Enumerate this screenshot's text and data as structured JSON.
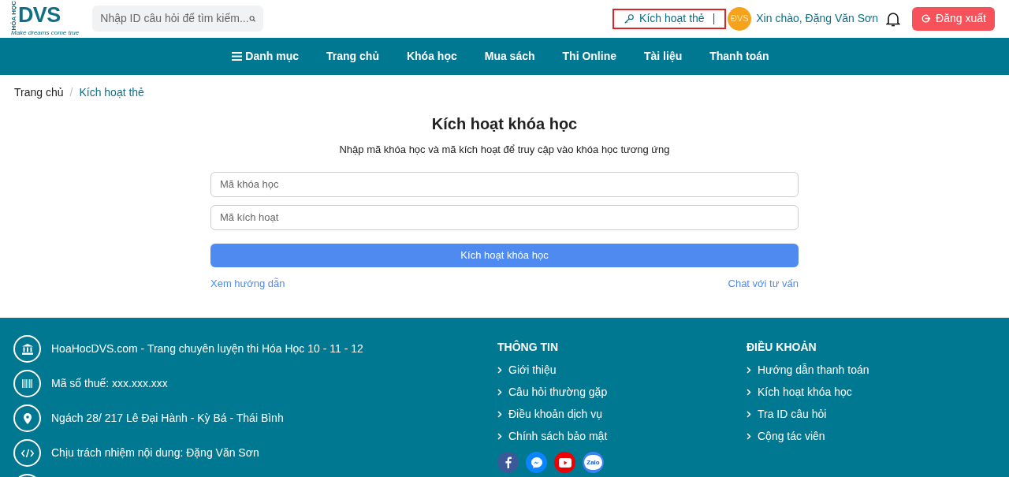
{
  "header": {
    "logo": {
      "vertical": "HÓA HỌC",
      "main": "DVS",
      "tagline": "Make dreams come true"
    },
    "search": {
      "placeholder": "Nhập ID câu hỏi để tìm kiếm..."
    },
    "activate_link": {
      "label": "Kích hoạt thẻ",
      "separator": "|",
      "highlighted": true
    },
    "avatar": "ĐVS",
    "greeting": "Xin chào, Đặng Văn Sơn",
    "logout": "Đăng xuất"
  },
  "nav": [
    {
      "label": "Danh mục",
      "kind": "menu"
    },
    {
      "label": "Trang chủ",
      "kind": "link"
    },
    {
      "label": "Khóa học",
      "kind": "link"
    },
    {
      "label": "Mua sách",
      "kind": "link"
    },
    {
      "label": "Thi Online",
      "kind": "link"
    },
    {
      "label": "Tài liệu",
      "kind": "link"
    },
    {
      "label": "Thanh toán",
      "kind": "link"
    }
  ],
  "breadcrumb_separator": "/",
  "breadcrumb": [
    {
      "label": "Trang chủ",
      "selected": false
    },
    {
      "label": "Kích hoạt thẻ",
      "selected": true
    }
  ],
  "form": {
    "title": "Kích hoạt khóa học",
    "subtitle": "Nhập mã khóa học và mã kích hoạt để truy cập vào khóa học tương ứng",
    "fields": [
      {
        "placeholder": "Mã khóa học"
      },
      {
        "placeholder": "Mã kích hoạt"
      }
    ],
    "submit": "Kích hoạt khóa học",
    "help_link": "Xem hướng dẫn",
    "chat_link": "Chat với tư vấn"
  },
  "footer": {
    "info": [
      {
        "kind": "bank",
        "text": "HoaHocDVS.com - Trang chuyên luyện thi Hóa Học 10 - 11 - 12"
      },
      {
        "kind": "barcode",
        "text": "Mã số thuế: xxx.xxx.xxx"
      },
      {
        "kind": "pin",
        "text": "Ngách 28/ 217 Lê Đại Hành - Kỳ Bá - Thái Bình"
      },
      {
        "kind": "code",
        "text": "Chịu trách nhiệm nội dung: Đặng Văn Sơn"
      },
      {
        "kind": "partial"
      }
    ],
    "columns": [
      {
        "title": "THÔNG TIN",
        "links": [
          "Giới thiệu",
          "Câu hỏi thường gặp",
          "Điều khoản dịch vụ",
          "Chính sách bảo mật"
        ]
      },
      {
        "title": "ĐIỀU KHOẢN",
        "links": [
          "Hướng dẫn thanh toán",
          "Kích hoạt khóa học",
          "Tra ID câu hỏi",
          "Cộng tác viên"
        ]
      }
    ],
    "socials": [
      {
        "kind": "facebook"
      },
      {
        "kind": "messenger"
      },
      {
        "kind": "youtube"
      },
      {
        "kind": "zalo",
        "label": "Zalo"
      }
    ]
  }
}
